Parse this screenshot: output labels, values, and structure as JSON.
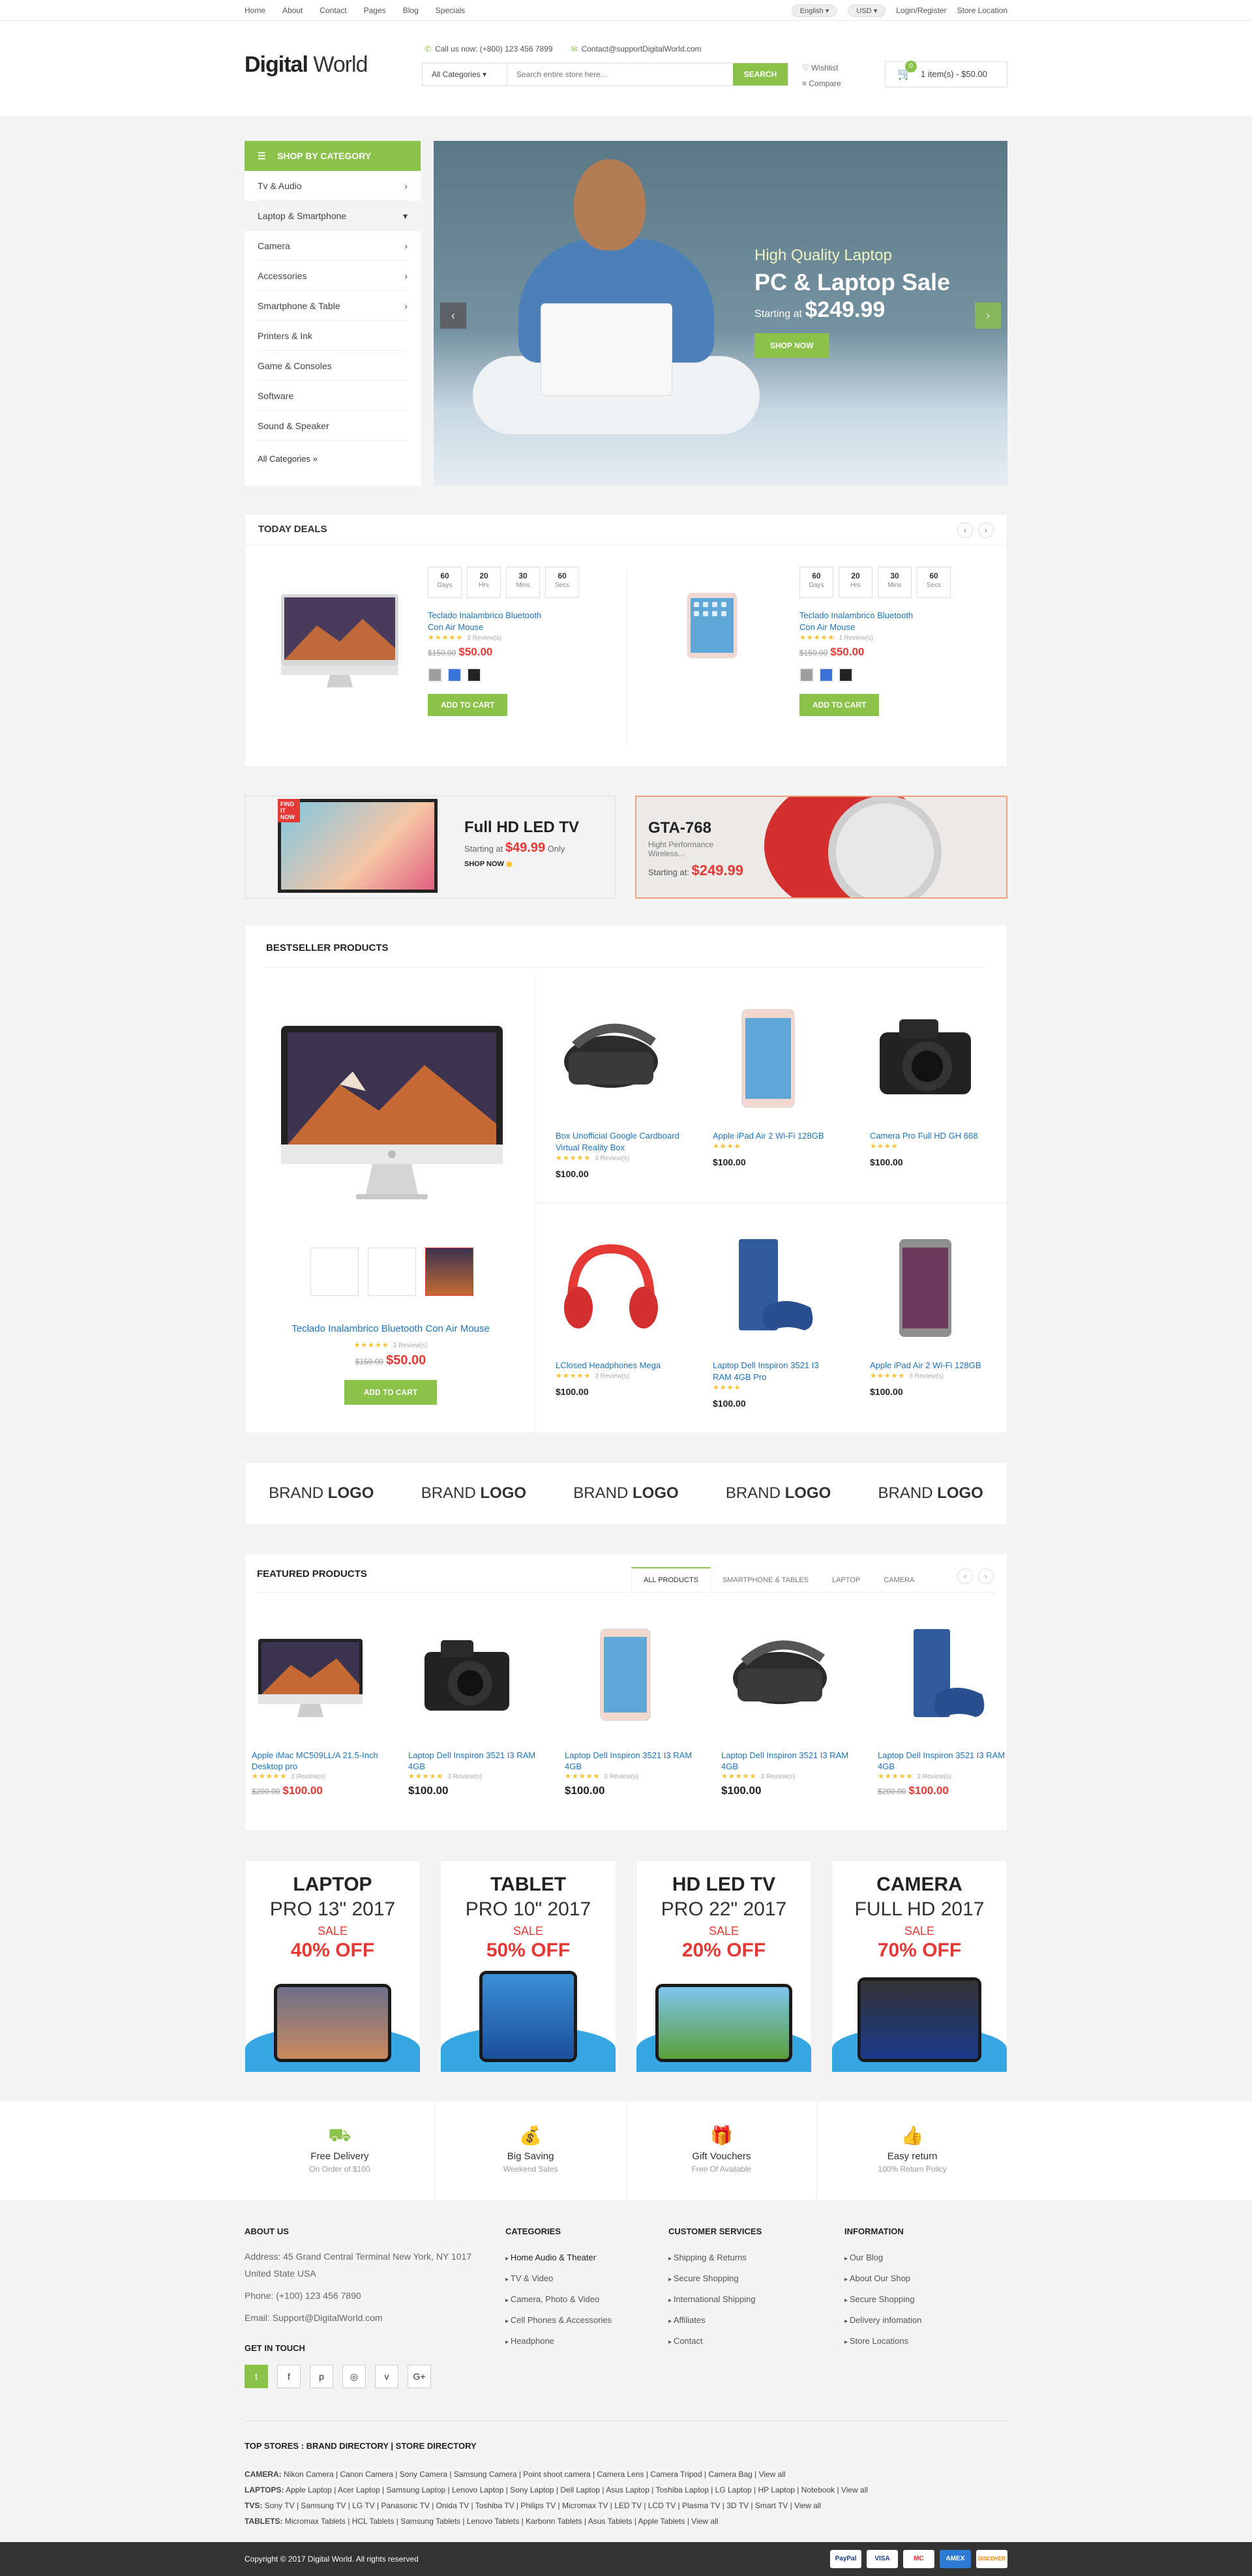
{
  "topbar": {
    "nav": [
      "Home",
      "About",
      "Contact",
      "Pages",
      "Blog",
      "Specials"
    ],
    "language": "English",
    "currency": "USD",
    "login": "Login/Register",
    "store": "Store Location"
  },
  "header": {
    "logo_bold": "Digital",
    "logo_light": " World",
    "phone": "Call us now: (+800) 123 456 7899",
    "email": "Contact@supportDigitalWorld.com",
    "category_select": "All Categories",
    "search_placeholder": "Search entire store here...",
    "search_label": "SEARCH",
    "wishlist": "Wishlist",
    "compare": "Compare",
    "cart_count": "0",
    "cart_text": "1 item(s) - $50.00"
  },
  "sidebar": {
    "title": "SHOP BY CATEGORY",
    "items": [
      "Tv & Audio",
      "Laptop & Smartphone",
      "Camera",
      "Accessories",
      "Smartphone & Table",
      "Printers & Ink",
      "Game & Consoles",
      "Software",
      "Sound & Speaker"
    ],
    "all": "All Categories"
  },
  "slide": {
    "line1": "High Quality Laptop",
    "line2": "PC & Laptop Sale",
    "starting": "Starting at",
    "price": "$249.99",
    "button": "SHOP NOW"
  },
  "deals": {
    "title": "TODAY DEALS",
    "items": [
      {
        "days": "60",
        "hrs": "20",
        "mins": "30",
        "secs": "60",
        "name": "Teclado Inalambrico Bluetooth Con Air Mouse",
        "reviews": "3 Review(s)",
        "old": "$150.00",
        "price": "$50.00",
        "button": "ADD TO CART"
      },
      {
        "days": "60",
        "hrs": "20",
        "mins": "30",
        "secs": "60",
        "name": "Teclado Inalambrico Bluetooth Con Air Mouse",
        "reviews": "1 Review(s)",
        "old": "$150.00",
        "price": "$50.00",
        "button": "ADD TO CART"
      }
    ],
    "labels": {
      "days": "Days",
      "hrs": "Hrs",
      "mins": "Mins",
      "secs": "Secs"
    }
  },
  "banners": {
    "b1": {
      "badge": "FIND IT NOW",
      "title": "Full HD LED TV",
      "starting": "Starting at",
      "price": "$49.99",
      "only": "Only",
      "link": "SHOP NOW"
    },
    "b2": {
      "title": "GTA-768",
      "sub1": "Hight Performance",
      "sub2": "Wireless...",
      "starting": "Starting at:",
      "price": "$249.99"
    }
  },
  "best": {
    "title": "BESTSELLER PRODUCTS",
    "main": {
      "name": "Teclado Inalambrico Bluetooth Con Air Mouse",
      "reviews": "3 Review(s)",
      "old": "$150.00",
      "price": "$50.00",
      "button": "ADD TO CART"
    },
    "grid": [
      {
        "name": "Box Unofficial Google Cardboard Virtual Reality Box",
        "reviews": "3 Review(s)",
        "price": "$100.00"
      },
      {
        "name": "Apple iPad Air 2 Wi-Fi 128GB",
        "reviews": "",
        "price": "$100.00"
      },
      {
        "name": "Camera Pro Full HD GH 668",
        "reviews": "",
        "price": "$100.00"
      },
      {
        "name": "LClosed Headphones Mega",
        "reviews": "3 Review(s)",
        "price": "$100.00"
      },
      {
        "name": "Laptop Dell Inspiron 3521 I3 RAM 4GB Pro",
        "reviews": "",
        "price": "$100.00"
      },
      {
        "name": "Apple iPad Air 2 Wi-Fi 128GB",
        "reviews": "3 Review(s)",
        "price": "$100.00"
      }
    ]
  },
  "brands": {
    "light": "BRAND",
    "bold": "LOGO"
  },
  "featured": {
    "title": "FEATURED PRODUCTS",
    "tabs": [
      "ALL PRODUCTS",
      "SMARTPHONE & TABLES",
      "LAPTOP",
      "CAMERA"
    ],
    "items": [
      {
        "name": "Apple iMac MC509LL/A 21.5-Inch Desktop pro",
        "reviews": "3 Review(s)",
        "old": "$200.00",
        "price": "$100.00"
      },
      {
        "name": "Laptop Dell Inspiron 3521 I3 RAM 4GB",
        "reviews": "3 Review(s)",
        "old": "",
        "price": "$100.00"
      },
      {
        "name": "Laptop Dell Inspiron 3521 I3 RAM 4GB",
        "reviews": "3 Review(s)",
        "old": "",
        "price": "$100.00"
      },
      {
        "name": "Laptop Dell Inspiron 3521 I3 RAM 4GB",
        "reviews": "3 Review(s)",
        "old": "",
        "price": "$100.00"
      },
      {
        "name": "Laptop Dell Inspiron 3521 I3 RAM 4GB",
        "reviews": "3 Review(s)",
        "old": "$200.00",
        "price": "$100.00"
      }
    ]
  },
  "promos": [
    {
      "t1": "LAPTOP",
      "t2": "PRO 13\" 2017",
      "sale": "SALE",
      "off": "40% OFF"
    },
    {
      "t1": "TABLET",
      "t2": "PRO 10\" 2017",
      "sale": "SALE",
      "off": "50% OFF"
    },
    {
      "t1": "HD LED TV",
      "t2": "PRO 22\" 2017",
      "sale": "SALE",
      "off": "20% OFF"
    },
    {
      "t1": "CAMERA",
      "t2": "FULL HD 2017",
      "sale": "SALE",
      "off": "70% OFF"
    }
  ],
  "services": [
    {
      "t": "Free Delivery",
      "s": "On Order of $100"
    },
    {
      "t": "Big Saving",
      "s": "Weekend Sales"
    },
    {
      "t": "Gift Vouchers",
      "s": "Free Of Available"
    },
    {
      "t": "Easy return",
      "s": "100% Return Policy"
    }
  ],
  "footer": {
    "about_title": "ABOUT US",
    "address": "Address: 45 Grand Central Terminal New York, NY 1017 United State USA",
    "phone": "Phone: (+100) 123 456 7890",
    "email": "Email: Support@DigitalWorld.com",
    "touch": "GET IN TOUCH",
    "cat_title": "CATEGORIES",
    "cats": [
      "Home Audio & Theater",
      "TV & Video",
      "Camera, Photo & Video",
      "Cell Phones & Accessories",
      "Headphone"
    ],
    "svc_title": "CUSTOMER SERVICES",
    "svcs": [
      "Shipping & Returns",
      "Secure Shopping",
      "International Shipping",
      "Affiliates",
      "Contact"
    ],
    "info_title": "INFORMATION",
    "infos": [
      "Our Blog",
      "About Our Shop",
      "Secure Shopping",
      "Delivery infomation",
      "Store Locations"
    ],
    "tops_title": "TOP STORES : BRAND DIRECTORY | STORE DIRECTORY",
    "tops": [
      {
        "k": "CAMERA:",
        "v": "Nikon Camera | Canon Camera | Sony Camera | Samsung Camera | Point shoot camera | Camera Lens | Camera Tripod | Camera Bag | View all"
      },
      {
        "k": "LAPTOPS:",
        "v": "Apple Laptop | Acer Laptop | Samsung Laptop | Lenovo Laptop | Sony Laptop | Dell Laptop | Asus Laptop | Toshiba Laptop | LG Laptop | HP Laptop | Notebook | View all"
      },
      {
        "k": "TVS:",
        "v": "Sony TV | Samsung TV | LG TV | Panasonic TV | Onida TV | Toshiba TV | Philips TV | Micromax TV | LED TV | LCD TV | Plasma TV | 3D TV | Smart TV | View all"
      },
      {
        "k": "TABLETS:",
        "v": "Micromax Tablets | HCL Tablets | Samsung Tablets | Lenovo Tablets | Karbonn Tablets | Asus Tablets | Apple Tablets | View all"
      }
    ],
    "copyright": "Copyright © 2017 Digital World. All rights reserved",
    "pay": [
      "PayPal",
      "VISA",
      "MC",
      "AMEX",
      "DISCOVER"
    ]
  }
}
